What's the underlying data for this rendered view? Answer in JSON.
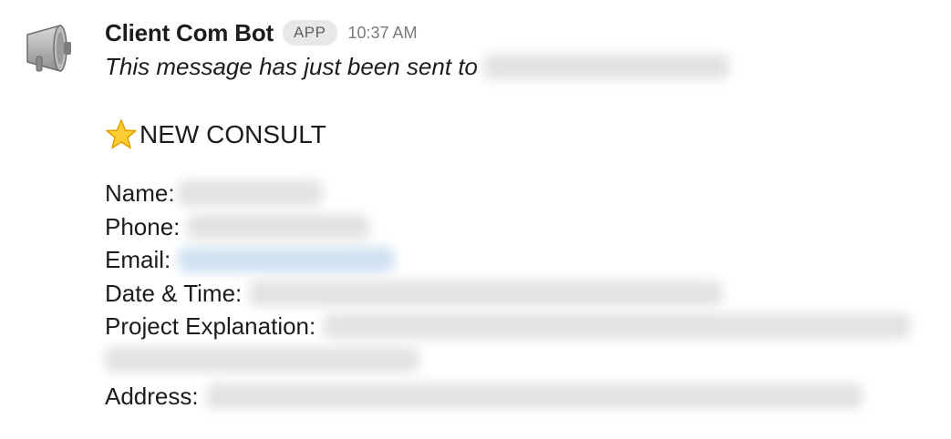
{
  "message": {
    "sender": "Client Com Bot",
    "badge": "APP",
    "time": "10:37 AM",
    "intro": "This message has just been sent to",
    "headline": "NEW CONSULT",
    "avatar_icon": "megaphone-icon",
    "headline_icon": "star-icon",
    "fields": [
      {
        "label": "Name:"
      },
      {
        "label": "Phone:"
      },
      {
        "label": "Email:"
      },
      {
        "label": "Date & Time:"
      },
      {
        "label": "Project Explanation:"
      },
      {
        "label": "Address:"
      }
    ]
  },
  "colors": {
    "text": "#1d1c1d",
    "badge_bg": "#e8e8e8",
    "timestamp": "#7a797a",
    "link_blur": "#cfe1f2"
  }
}
